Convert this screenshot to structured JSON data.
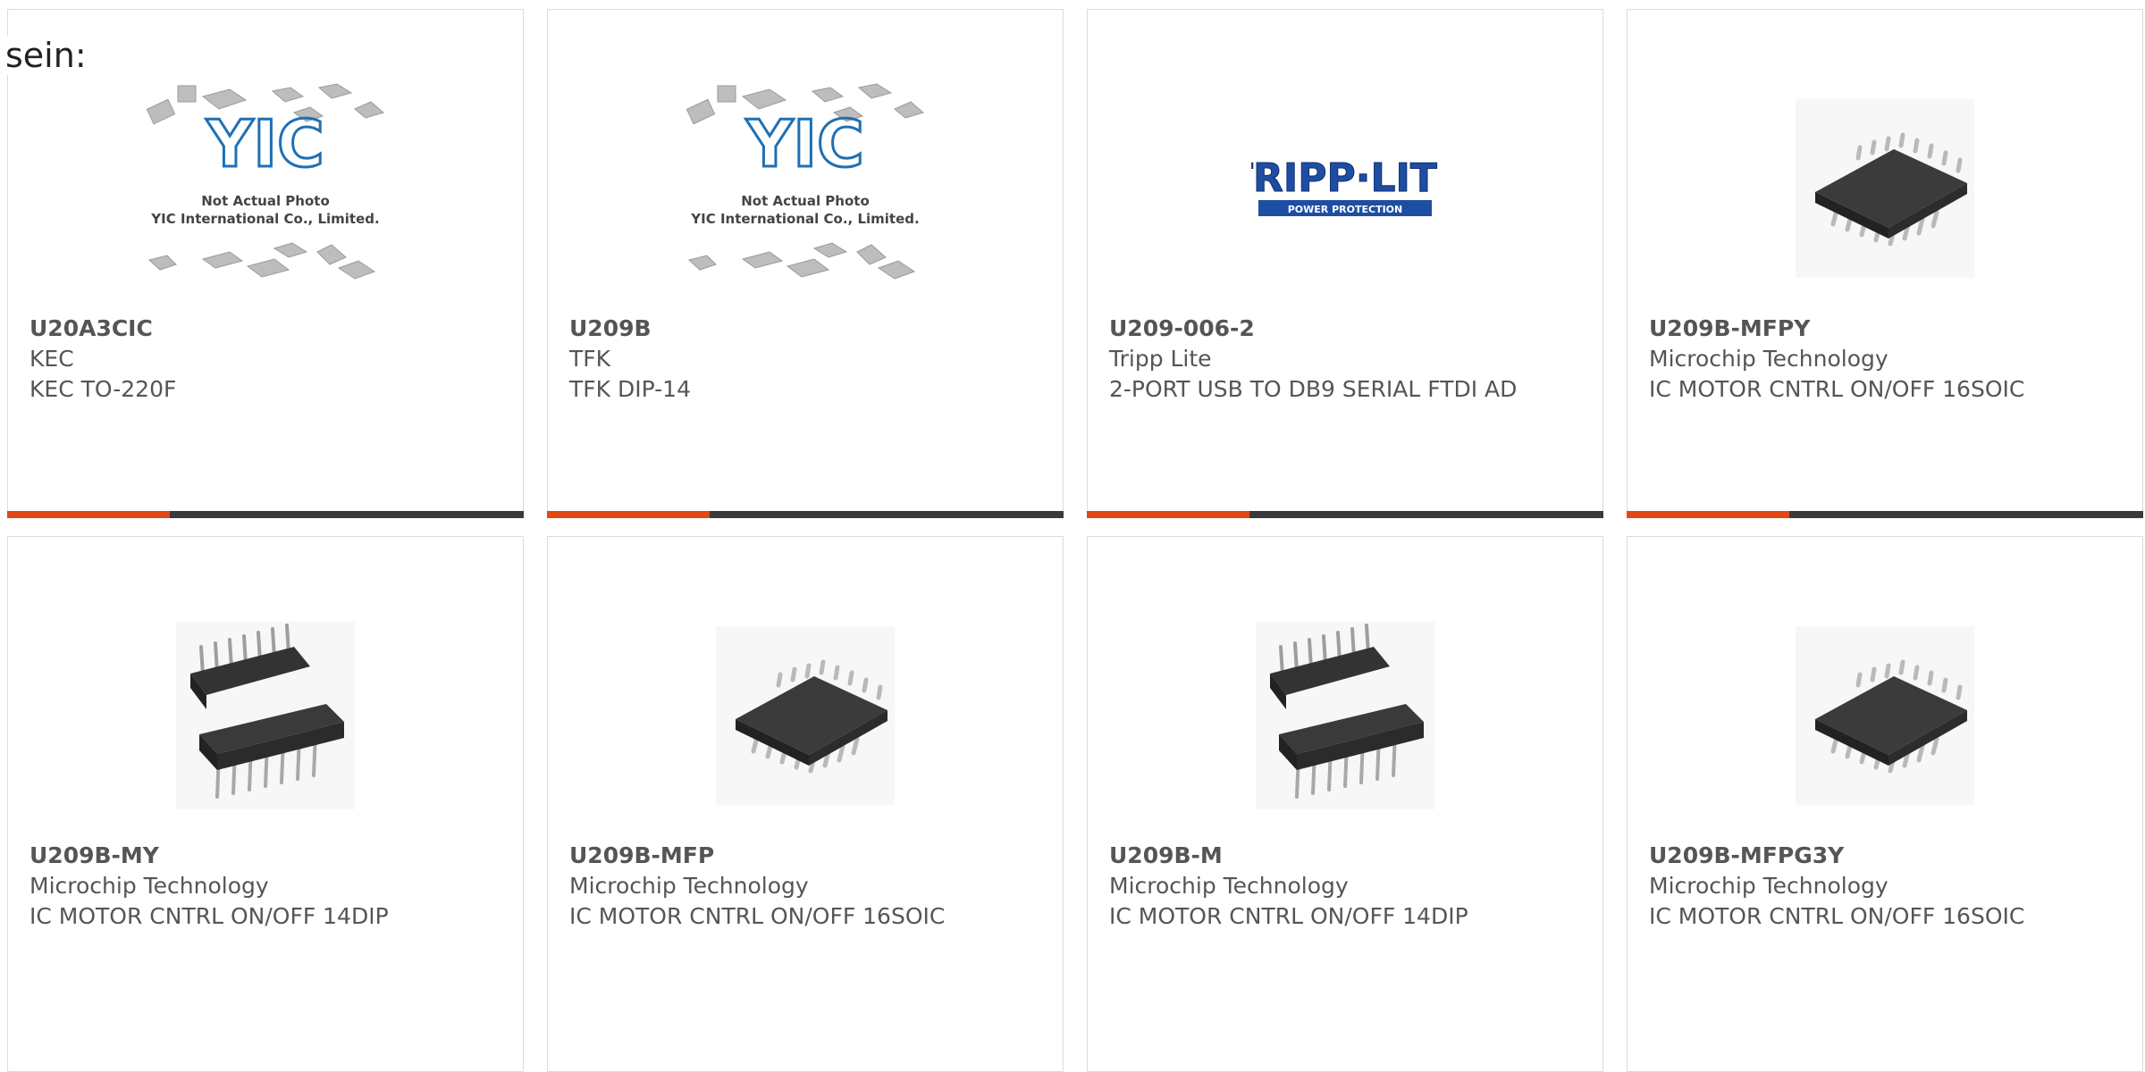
{
  "lead_text": "sein:",
  "colors": {
    "accent": "#e24814",
    "bar": "#3a3a3a",
    "border": "#dcdcdc"
  },
  "products": [
    {
      "part": "U20A3CIC",
      "maker": "KEC",
      "desc": "KEC TO-220F",
      "image": "yic-placeholder",
      "placeholder": {
        "brand": "YIC",
        "line1": "Not Actual Photo",
        "line2": "YIC International Co., Limited."
      }
    },
    {
      "part": "U209B",
      "maker": "TFK",
      "desc": "TFK DIP-14",
      "image": "yic-placeholder",
      "placeholder": {
        "brand": "YIC",
        "line1": "Not Actual Photo",
        "line2": "YIC International Co., Limited."
      }
    },
    {
      "part": "U209-006-2",
      "maker": "Tripp Lite",
      "desc": "2-PORT USB TO DB9 SERIAL FTDI AD",
      "image": "tripp-lite-logo",
      "logo": {
        "name": "TRIPP·LITE",
        "tagline": "POWER PROTECTION"
      }
    },
    {
      "part": "U209B-MFPY",
      "maker": "Microchip Technology",
      "desc": "IC MOTOR CNTRL ON/OFF 16SOIC",
      "image": "soic-chip"
    },
    {
      "part": "U209B-MY",
      "maker": "Microchip Technology",
      "desc": "IC MOTOR CNTRL ON/OFF 14DIP",
      "image": "dip-chips"
    },
    {
      "part": "U209B-MFP",
      "maker": "Microchip Technology",
      "desc": "IC MOTOR CNTRL ON/OFF 16SOIC",
      "image": "soic-chip"
    },
    {
      "part": "U209B-M",
      "maker": "Microchip Technology",
      "desc": "IC MOTOR CNTRL ON/OFF 14DIP",
      "image": "dip-chips"
    },
    {
      "part": "U209B-MFPG3Y",
      "maker": "Microchip Technology",
      "desc": "IC MOTOR CNTRL ON/OFF 16SOIC",
      "image": "soic-chip"
    }
  ]
}
